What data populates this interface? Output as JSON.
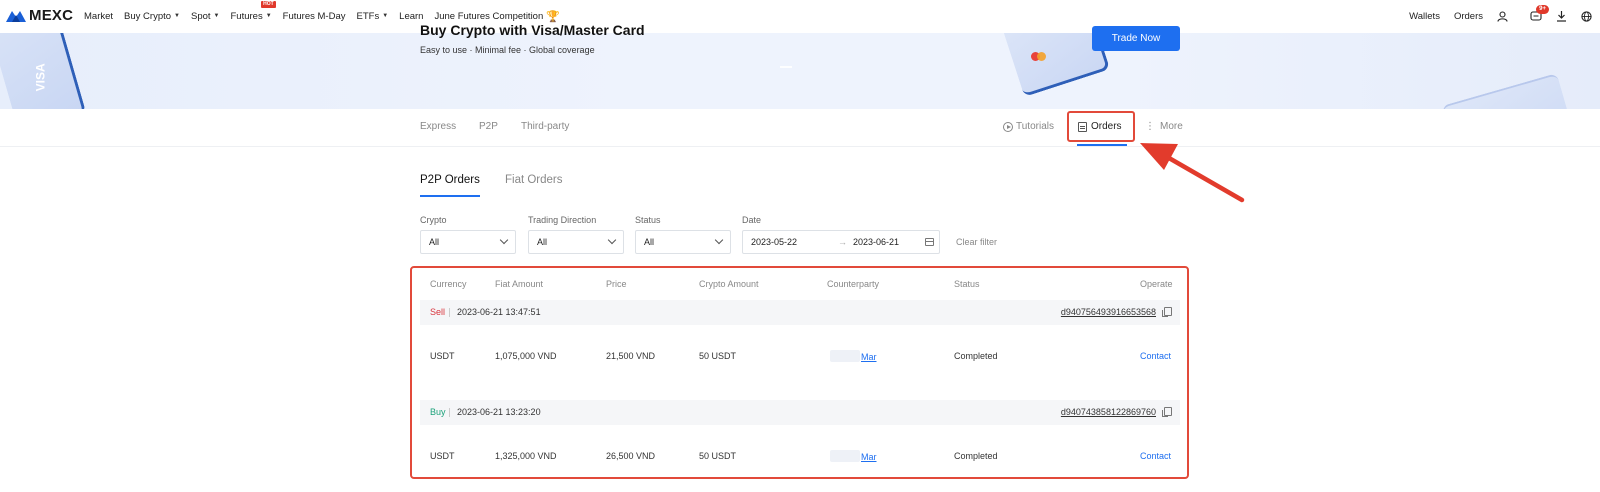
{
  "nav": {
    "brand": "MEXC",
    "items": [
      "Market",
      "Buy Crypto",
      "Spot",
      "Futures",
      "Futures M-Day",
      "ETFs",
      "Learn",
      "June Futures Competition"
    ],
    "hot_badge": "HOT",
    "right": {
      "wallets": "Wallets",
      "orders": "Orders",
      "notif_badge": "9+"
    }
  },
  "banner": {
    "title": "Buy Crypto with Visa/Master Card",
    "subtitle": "Easy to use · Minimal fee · Global coverage",
    "cta": "Trade Now",
    "card_text": "VISA"
  },
  "subnav": {
    "tabs": [
      "Express",
      "P2P",
      "Third-party"
    ],
    "tutorials": "Tutorials",
    "orders": "Orders",
    "more": "More"
  },
  "order_tabs": [
    "P2P Orders",
    "Fiat Orders"
  ],
  "filters": {
    "crypto": {
      "label": "Crypto",
      "value": "All"
    },
    "direction": {
      "label": "Trading Direction",
      "value": "All"
    },
    "status": {
      "label": "Status",
      "value": "All"
    },
    "date": {
      "label": "Date",
      "from": "2023-05-22",
      "separator": "→",
      "to": "2023-06-21"
    },
    "clear": "Clear filter"
  },
  "table": {
    "headers": [
      "Currency",
      "Fiat Amount",
      "Price",
      "Crypto Amount",
      "Counterparty",
      "Status",
      "Operate"
    ],
    "orders": [
      {
        "side": "Sell",
        "time": "2023-06-21 13:47:51",
        "order_id": "d940756493916653568",
        "currency": "USDT",
        "fiat_amount": "1,075,000 VND",
        "price": "21,500 VND",
        "crypto_amount": "50 USDT",
        "counterparty": "Mar",
        "status": "Completed",
        "operate": "Contact"
      },
      {
        "side": "Buy",
        "time": "2023-06-21 13:23:20",
        "order_id": "d940743858122869760",
        "currency": "USDT",
        "fiat_amount": "1,325,000 VND",
        "price": "26,500 VND",
        "crypto_amount": "50 USDT",
        "counterparty": "Mar",
        "status": "Completed",
        "operate": "Contact"
      }
    ]
  },
  "colors": {
    "accent": "#1e6ff0",
    "highlight": "#e24a3a",
    "sell": "#d9363e",
    "buy": "#1ba27a"
  }
}
